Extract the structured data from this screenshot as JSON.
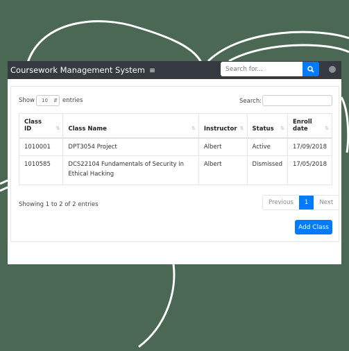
{
  "navbar": {
    "title": "Coursework Management System",
    "menu_icon": "hamburger-icon",
    "search_placeholder": "Search for...",
    "search_icon": "search-icon",
    "user_icon": "user-circle-icon"
  },
  "controls": {
    "show_label": "Show",
    "entries_value": "10",
    "entries_label": "entries",
    "search_label": "Search:"
  },
  "table": {
    "headers": [
      [
        "Class",
        "ID"
      ],
      [
        "Class Name"
      ],
      [
        "Instructor"
      ],
      [
        "Status"
      ],
      [
        "Enroll",
        "date"
      ]
    ],
    "rows": [
      [
        "1010001",
        "DPT3054 Project",
        "Albert",
        "Active",
        "17/09/2018"
      ],
      [
        "1010585",
        "DCS22104 Fundamentals of Security in Ethical Hacking",
        "Albert",
        "Dismissed",
        "17/05/2018"
      ]
    ]
  },
  "footer": {
    "info": "Showing 1 to 2 of 2 entries",
    "previous": "Previous",
    "page": "1",
    "next": "Next",
    "add_button": "Add Class"
  },
  "colors": {
    "background": "#4a6854",
    "navbar": "#343a40",
    "primary": "#007bff"
  }
}
